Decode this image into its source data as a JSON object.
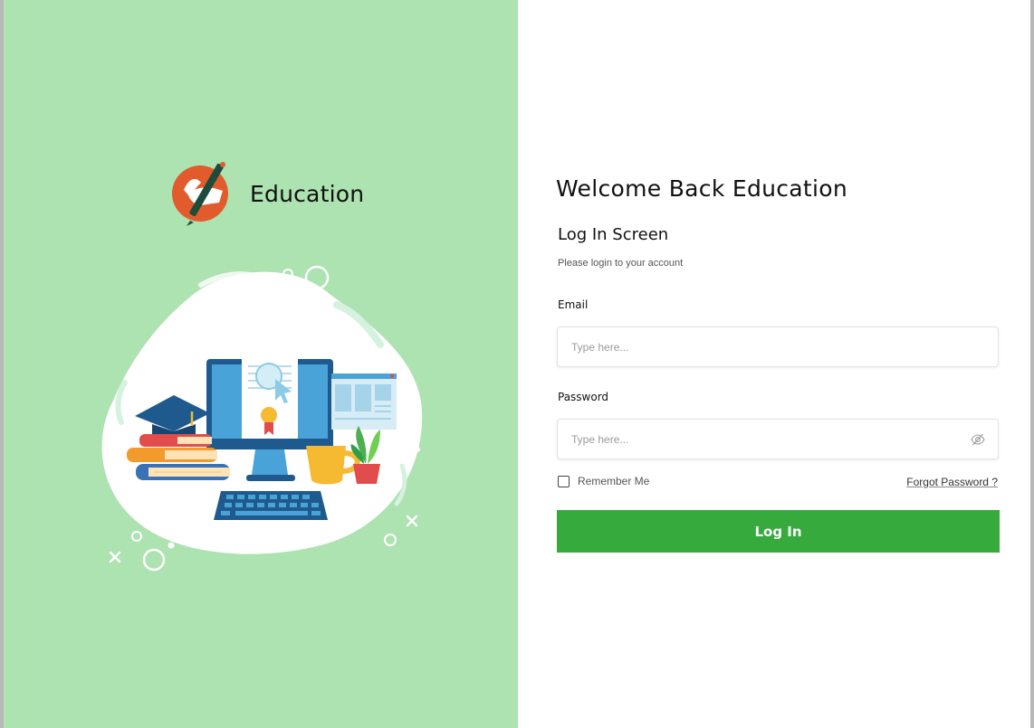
{
  "brand": {
    "name": "Education",
    "logo_icon": "pencil-hand-logo-icon"
  },
  "illustration": {
    "icon": "education-illustration"
  },
  "login": {
    "heading": "Welcome Back Education",
    "subtitle": "Log In Screen",
    "hint": "Please login to your account",
    "email_label": "Email",
    "email_placeholder": "Type here...",
    "email_value": "",
    "password_label": "Password",
    "password_placeholder": "Type here...",
    "password_value": "",
    "password_toggle_icon": "eye-off-icon",
    "remember_label": "Remember Me",
    "remember_checked": false,
    "forgot_label": "Forgot Password ?",
    "submit_label": "Log In"
  },
  "colors": {
    "left_panel": "#ade2b1",
    "primary_button": "#37aa3e",
    "logo_accent": "#e15b2d"
  }
}
